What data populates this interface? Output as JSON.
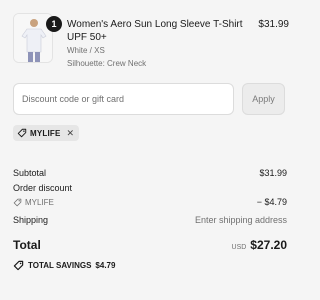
{
  "product": {
    "title": "Women's Aero Sun Long Sleeve T-Shirt UPF 50+",
    "variant": "White / XS",
    "silhouette": "Silhouette: Crew Neck",
    "price": "$31.99",
    "quantity": "1",
    "image_icon": "shirt-thumbnail"
  },
  "discount": {
    "placeholder": "Discount code or gift card",
    "apply_label": "Apply",
    "applied_code": "MYLIFE",
    "remove_icon": "close-icon"
  },
  "summary": {
    "subtotal_label": "Subtotal",
    "subtotal_value": "$31.99",
    "order_discount_label": "Order discount",
    "order_discount_code": "MYLIFE",
    "order_discount_value": "− $4.79",
    "shipping_label": "Shipping",
    "shipping_value": "Enter shipping address"
  },
  "total": {
    "label": "Total",
    "currency": "USD",
    "amount": "$27.20"
  },
  "savings": {
    "label": "TOTAL SAVINGS",
    "amount": "$4.79"
  }
}
